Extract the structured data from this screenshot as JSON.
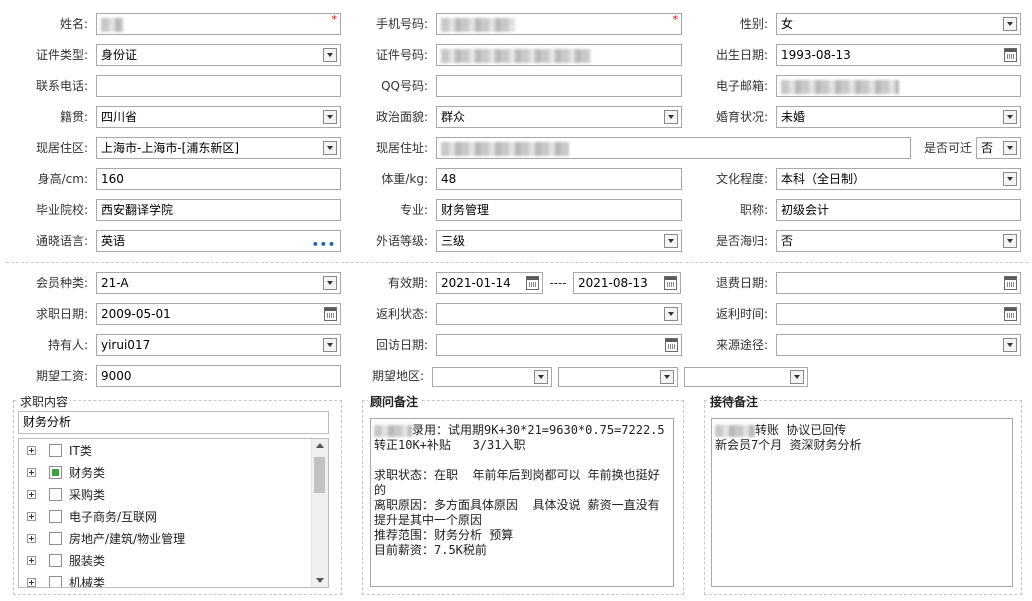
{
  "basic": {
    "name": {
      "label": "姓名:",
      "value": ""
    },
    "mobile": {
      "label": "手机号码:",
      "value": ""
    },
    "gender": {
      "label": "性别:",
      "value": "女"
    },
    "id_type": {
      "label": "证件类型:",
      "value": "身份证"
    },
    "id_no": {
      "label": "证件号码:",
      "value": ""
    },
    "birth": {
      "label": "出生日期:",
      "value": "1993-08-13"
    },
    "phone": {
      "label": "联系电话:",
      "value": ""
    },
    "qq": {
      "label": "QQ号码:",
      "value": ""
    },
    "email": {
      "label": "电子邮箱:",
      "value": ""
    },
    "native": {
      "label": "籍贯:",
      "value": "四川省"
    },
    "political": {
      "label": "政治面貌:",
      "value": "群众"
    },
    "marital": {
      "label": "婚育状况:",
      "value": "未婚"
    },
    "region": {
      "label": "现居住区:",
      "value": "上海市-上海市-[浦东新区]"
    },
    "address": {
      "label": "现居住址:",
      "value": ""
    },
    "relocate": {
      "label": "是否可迁",
      "value": "否"
    },
    "height": {
      "label": "身高/cm:",
      "value": "160"
    },
    "weight": {
      "label": "体重/kg:",
      "value": "48"
    },
    "education": {
      "label": "文化程度:",
      "value": "本科（全日制）"
    },
    "school": {
      "label": "毕业院校:",
      "value": "西安翻译学院"
    },
    "major": {
      "label": "专业:",
      "value": "财务管理"
    },
    "title": {
      "label": "职称:",
      "value": "初级会计"
    },
    "language": {
      "label": "通晓语言:",
      "value": "英语"
    },
    "lang_level": {
      "label": "外语等级:",
      "value": "三级"
    },
    "overseas": {
      "label": "是否海归:",
      "value": "否"
    }
  },
  "member": {
    "type": {
      "label": "会员种类:",
      "value": "21-A"
    },
    "valid": {
      "label": "有效期:",
      "from": "2021-01-14",
      "dash": "----",
      "to": "2021-08-13"
    },
    "refund_date": {
      "label": "退费日期:",
      "value": ""
    },
    "job_date": {
      "label": "求职日期:",
      "value": "2009-05-01"
    },
    "rebate_status": {
      "label": "返利状态:",
      "value": ""
    },
    "rebate_time": {
      "label": "返利时间:",
      "value": ""
    },
    "holder": {
      "label": "持有人:",
      "value": "yirui017"
    },
    "visit_date": {
      "label": "回访日期:",
      "value": ""
    },
    "source": {
      "label": "来源途径:",
      "value": ""
    },
    "salary": {
      "label": "期望工资:",
      "value": "9000"
    },
    "area": {
      "label": "期望地区:",
      "value": ""
    }
  },
  "job": {
    "title": "求职内容",
    "search_value": "财务分析",
    "tree": [
      {
        "label": "IT类",
        "checked": false
      },
      {
        "label": "财务类",
        "checked": true
      },
      {
        "label": "采购类",
        "checked": false
      },
      {
        "label": "电子商务/互联网",
        "checked": false
      },
      {
        "label": "房地产/建筑/物业管理",
        "checked": false
      },
      {
        "label": "服装类",
        "checked": false
      },
      {
        "label": "机械类",
        "checked": false
      }
    ]
  },
  "advisor": {
    "title": "顾问备注",
    "text": "录用：试用期9K+30*21=9630*0.75=7222.5  转正10K+补贴   3/31入职\n\n求职状态：在职  年前年后到岗都可以 年前换也挺好的\n离职原因：多方面具体原因  具体没说 薪资一直没有提升是其中一个原因\n推荐范围：财务分析 预算\n目前薪资：7.5K税前"
  },
  "reception": {
    "title": "接待备注",
    "text": "转账 协议已回传\n新会员7个月 资深财务分析"
  }
}
